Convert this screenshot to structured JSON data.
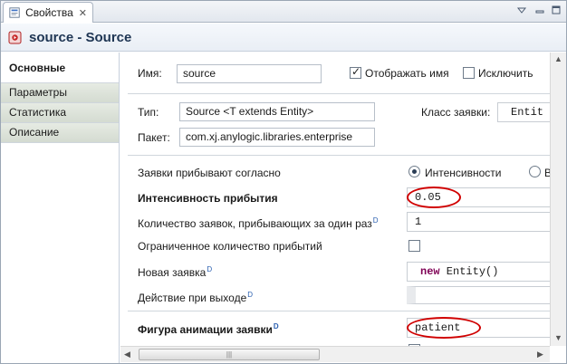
{
  "tab": {
    "label": "Свойства",
    "close": "✕"
  },
  "title": {
    "text": "source - Source"
  },
  "nav": [
    {
      "label": "Основные"
    },
    {
      "label": "Параметры"
    },
    {
      "label": "Статистика"
    },
    {
      "label": "Описание"
    }
  ],
  "general": {
    "name_label": "Имя:",
    "name_value": "source",
    "show_name_label": "Отображать имя",
    "show_name_checked": true,
    "exclude_label": "Исключить",
    "exclude_checked": false,
    "type_label": "Тип:",
    "type_value": "Source <T extends Entity>",
    "class_label": "Класс заявки:",
    "class_value": "Entit",
    "package_label": "Пакет:",
    "package_value": "com.xj.anylogic.libraries.enterprise"
  },
  "params": {
    "arrival_label": "Заявки прибывают согласно",
    "radio_intensity": "Интенсивности",
    "radio_second": "В",
    "rate_label": "Интенсивность прибытия",
    "rate_value": "0.05",
    "per_arrival_label": "Количество заявок, прибывающих за один раз",
    "per_arrival_value": "1",
    "limited_label": "Ограниченное количество прибытий",
    "limited_checked": false,
    "new_entity_label": "Новая заявка",
    "new_entity_keyword": "new",
    "new_entity_value": " Entity()",
    "on_exit_label": "Действие при выходе",
    "on_exit_value": "",
    "shape_label": "Фигура анимации заявки",
    "shape_value": "patient",
    "dynamic_marker": "D"
  },
  "scrollbar": {
    "thumb_grip": "|||"
  },
  "colors": {
    "highlight_oval": "#d00000",
    "keyword": "#7f0055"
  }
}
